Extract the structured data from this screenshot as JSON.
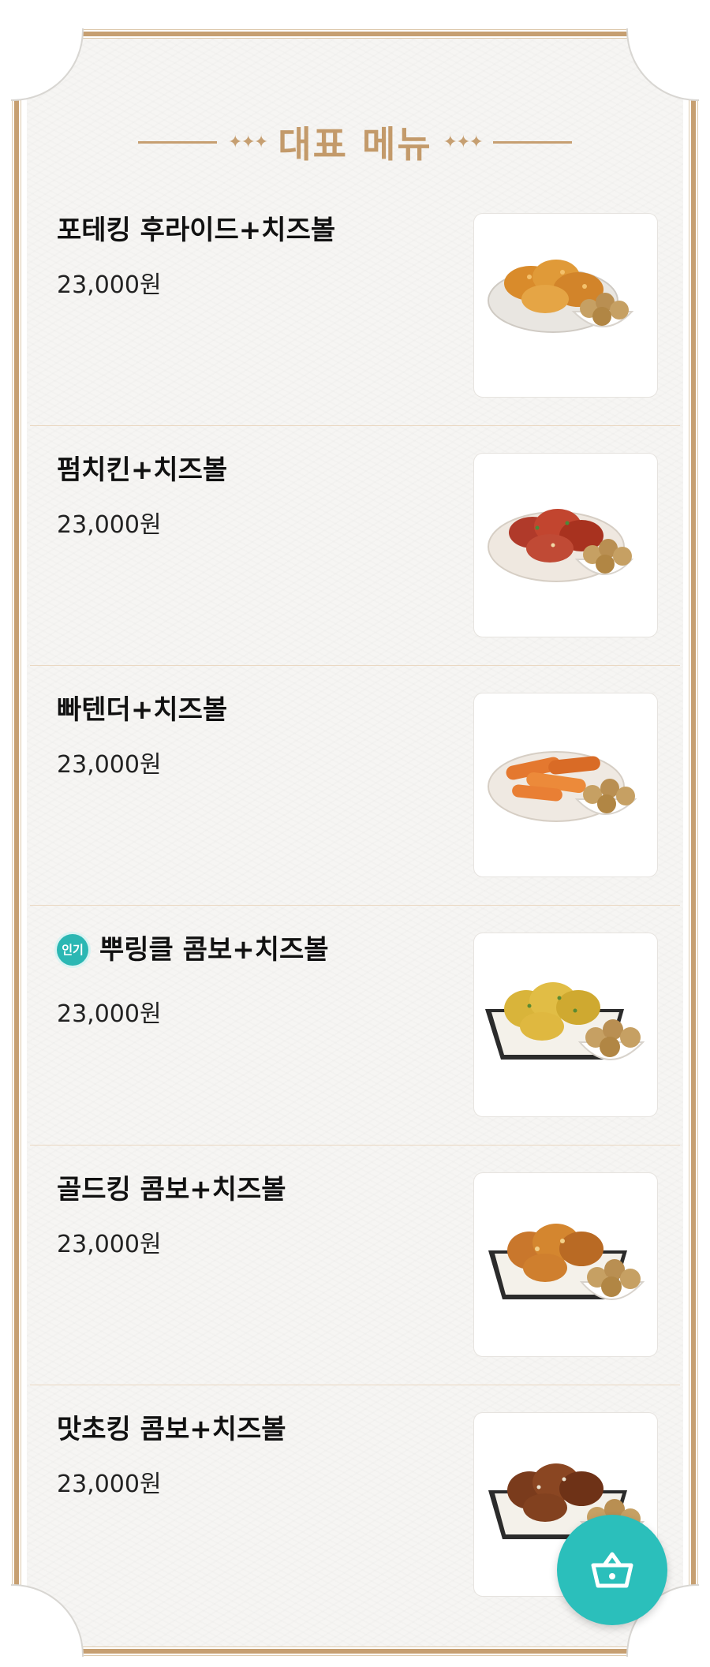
{
  "section": {
    "title": "대표 메뉴"
  },
  "menu_items": [
    {
      "name": "포테킹 후라이드+치즈볼",
      "price": "23,000원",
      "badge": "",
      "image": "fried-chicken-cheeseball-image"
    },
    {
      "name": "펌치킨+치즈볼",
      "price": "23,000원",
      "badge": "",
      "image": "spicy-chicken-cheeseball-image"
    },
    {
      "name": "빠텐더+치즈볼",
      "price": "23,000원",
      "badge": "",
      "image": "tender-chicken-cheeseball-image"
    },
    {
      "name": "뿌링클 콤보+치즈볼",
      "price": "23,000원",
      "badge": "인기",
      "image": "combo-chicken-cheeseball-image"
    },
    {
      "name": "골드킹 콤보+치즈볼",
      "price": "23,000원",
      "badge": "",
      "image": "gold-combo-cheeseball-image"
    },
    {
      "name": "맛초킹 콤보+치즈볼",
      "price": "23,000원",
      "badge": "",
      "image": "matcho-combo-cheeseball-image"
    }
  ],
  "cart_button": {
    "icon": "basket-icon"
  },
  "colors": {
    "accent_gold": "#c69f71",
    "teal": "#2bbfbb"
  }
}
